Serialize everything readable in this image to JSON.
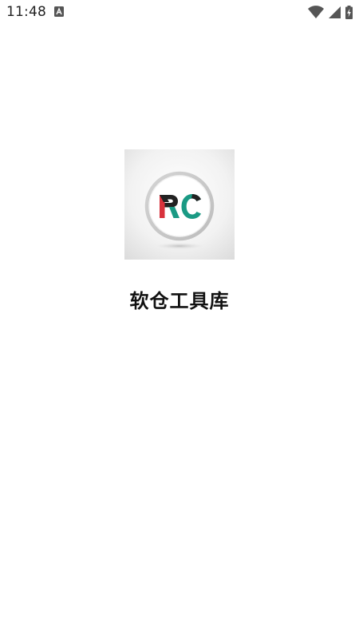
{
  "status_bar": {
    "time": "11:48",
    "icons": [
      "app-notification-icon",
      "wifi-icon",
      "cell-signal-icon",
      "battery-charging-icon"
    ]
  },
  "splash": {
    "logo_text": "RC",
    "app_name": "软仓工具库"
  },
  "colors": {
    "background": "#ffffff",
    "logo_red": "#d8323c",
    "logo_green": "#1a9a84",
    "logo_dark": "#222222"
  }
}
